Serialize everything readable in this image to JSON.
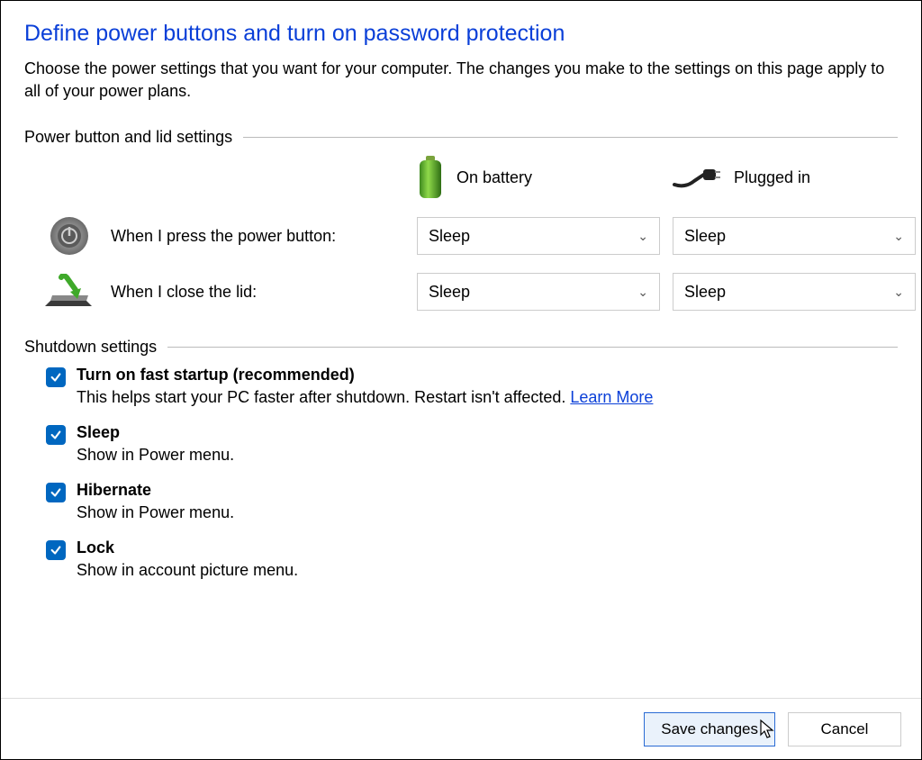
{
  "header": {
    "title": "Define power buttons and turn on password protection",
    "subtitle": "Choose the power settings that you want for your computer. The changes you make to the settings on this page apply to all of your power plans."
  },
  "sections": {
    "power_lid_title": "Power button and lid settings",
    "shutdown_title": "Shutdown settings"
  },
  "columns": {
    "battery": "On battery",
    "plugged": "Plugged in"
  },
  "rows": {
    "power_button_label": "When I press the power button:",
    "close_lid_label": "When I close the lid:"
  },
  "selects": {
    "power_battery": "Sleep",
    "power_plugged": "Sleep",
    "lid_battery": "Sleep",
    "lid_plugged": "Sleep"
  },
  "shutdown": {
    "fast_startup": {
      "title": "Turn on fast startup (recommended)",
      "desc": "This helps start your PC faster after shutdown. Restart isn't affected. ",
      "link": "Learn More"
    },
    "sleep": {
      "title": "Sleep",
      "desc": "Show in Power menu."
    },
    "hibernate": {
      "title": "Hibernate",
      "desc": "Show in Power menu."
    },
    "lock": {
      "title": "Lock",
      "desc": "Show in account picture menu."
    }
  },
  "footer": {
    "save": "Save changes",
    "cancel": "Cancel"
  }
}
